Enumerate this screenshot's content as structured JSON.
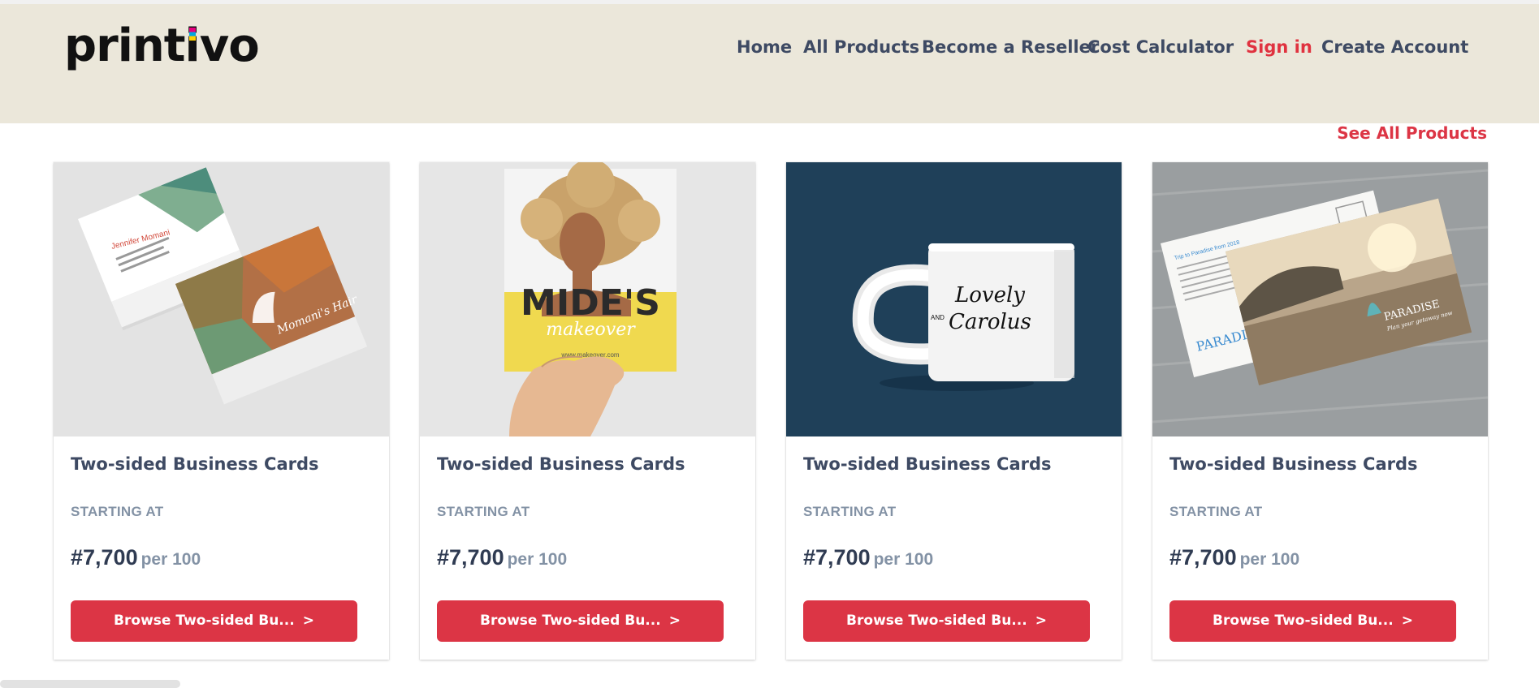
{
  "brand": {
    "logo_left": "print",
    "logo_i": "i",
    "logo_right": "vo"
  },
  "nav": {
    "home": "Home",
    "all_products": "All Products",
    "reseller": "Become a Reseller",
    "calculator": "Cost Calculator",
    "sign_in": "Sign in",
    "create_account": "Create Account"
  },
  "section": {
    "see_all": "See All Products"
  },
  "products": [
    {
      "title": "Two-sided Business Cards",
      "starting": "STARTING AT",
      "price": "#7,700",
      "unit": "per 100",
      "button": "Browse Two-sided Bu...",
      "arrow": ">",
      "image": {
        "kind": "business-cards",
        "card_name": "Jennifer Momani",
        "brand_text": "Momani's Hair"
      }
    },
    {
      "title": "Two-sided Business Cards",
      "starting": "STARTING AT",
      "price": "#7,700",
      "unit": "per 100",
      "button": "Browse Two-sided Bu...",
      "arrow": ">",
      "image": {
        "kind": "flyer",
        "headline": "MIDE'S",
        "script": "makeover",
        "url": "www.makeover.com"
      }
    },
    {
      "title": "Two-sided Business Cards",
      "starting": "STARTING AT",
      "price": "#7,700",
      "unit": "per 100",
      "button": "Browse Two-sided Bu...",
      "arrow": ">",
      "image": {
        "kind": "mug",
        "line1": "Lovely",
        "line_and": "AND",
        "line2": "Carolus"
      }
    },
    {
      "title": "Two-sided Business Cards",
      "starting": "STARTING AT",
      "price": "#7,700",
      "unit": "per 100",
      "button": "Browse Two-sided Bu...",
      "arrow": ">",
      "image": {
        "kind": "postcard",
        "trip": "Trip to Paradise from 2018",
        "brand_left": "PARADISE",
        "brand_right": "PARADISE",
        "tagline": "Plan your getaway now"
      }
    }
  ],
  "colors": {
    "header_bg": "#ebe7da",
    "accent": "#dc3545",
    "nav_text": "#3e4a63",
    "muted": "#8392a5"
  }
}
